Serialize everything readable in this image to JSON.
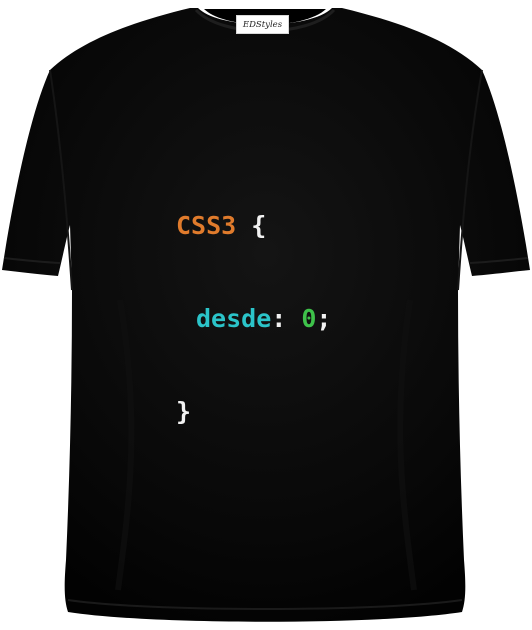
{
  "garment": {
    "label_text": "EDStyles",
    "shirt_color": "#060606",
    "background_color": "#ffffff"
  },
  "print": {
    "selector": "CSS3",
    "open_brace": "{",
    "property": "desde",
    "colon": ":",
    "value": "0",
    "semicolon": ";",
    "close_brace": "}",
    "colors": {
      "selector": "#e07b2c",
      "property": "#2bc4c9",
      "value": "#3ec24a",
      "punctuation": "#f2f2f2"
    }
  }
}
